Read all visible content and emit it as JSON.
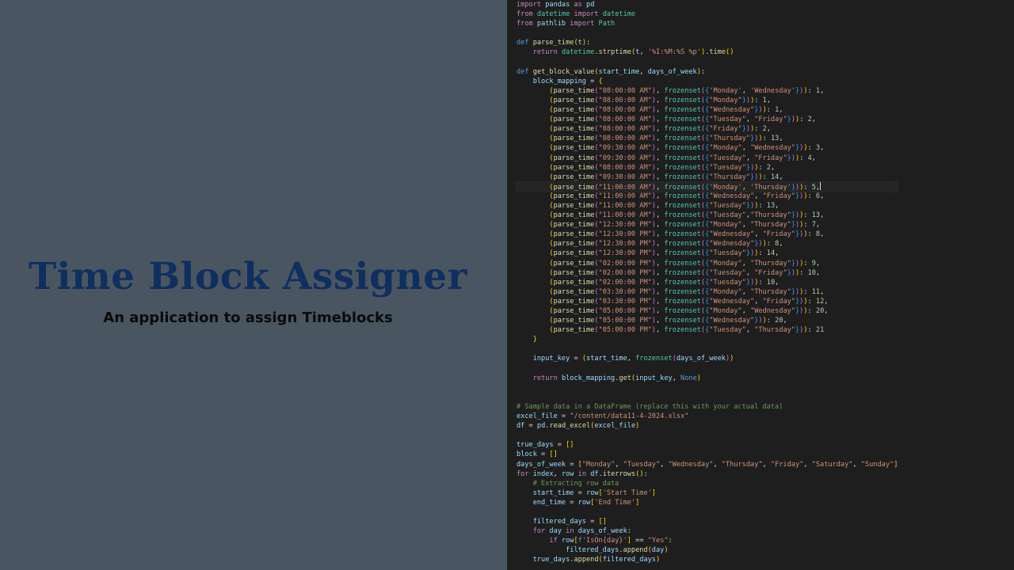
{
  "slide": {
    "title": "Time Block Assigner",
    "subtitle": "An application to assign Timeblocks"
  },
  "editor": {
    "cursor_line": 20,
    "lines": [
      "import pandas as pd",
      "from datetime import datetime",
      "from pathlib import Path",
      "",
      "def parse_time(t):",
      "    return datetime.strptime(t, '%I:%M:%S %p').time()",
      "",
      "def get_block_value(start_time, days_of_week):",
      "    block_mapping = {",
      "        (parse_time(\"08:00:00 AM\"), frozenset({'Monday', 'Wednesday'})): 1,",
      "        (parse_time(\"08:00:00 AM\"), frozenset({\"Monday\"})): 1,",
      "        (parse_time(\"08:00:00 AM\"), frozenset({\"Wednesday\"})): 1,",
      "        (parse_time(\"08:00:00 AM\"), frozenset({\"Tuesday\", \"Friday\"})): 2,",
      "        (parse_time(\"08:00:00 AM\"), frozenset({\"Friday\"})): 2,",
      "        (parse_time(\"08:00:00 AM\"), frozenset({\"Thursday\"})): 13,",
      "        (parse_time(\"09:30:00 AM\"), frozenset({\"Monday\", \"Wednesday\"})): 3,",
      "        (parse_time(\"09:30:00 AM\"), frozenset({\"Tuesday\", \"Friday\"})): 4,",
      "        (parse_time(\"08:00:00 AM\"), frozenset({\"Tuesday\"})): 2,",
      "        (parse_time(\"09:30:00 AM\"), frozenset({\"Thursday\"})): 14,",
      "        (parse_time(\"11:00:00 AM\"), frozenset({'Monday', 'Thursday'})): 5,",
      "        (parse_time(\"11:00:00 AM\"), frozenset({\"Wednesday\", \"Friday\"})): 6,",
      "        (parse_time(\"11:00:00 AM\"), frozenset({\"Tuesday\"})): 13,",
      "        (parse_time(\"11:00:00 AM\"), frozenset({\"Tuesday\",\"Thursday\"})): 13,",
      "        (parse_time(\"12:30:00 PM\"), frozenset({\"Monday\", \"Thursday\"})): 7,",
      "        (parse_time(\"12:30:00 PM\"), frozenset({\"Wednesday\", \"Friday\"})): 8,",
      "        (parse_time(\"12:30:00 PM\"), frozenset({\"Wednesday\"})): 8,",
      "        (parse_time(\"12:30:00 PM\"), frozenset({\"Tuesday\"})): 14,",
      "        (parse_time(\"02:00:00 PM\"), frozenset({\"Monday\", \"Thursday\"})): 9,",
      "        (parse_time(\"02:00:00 PM\"), frozenset({\"Tuesday\", \"Friday\"})): 10,",
      "        (parse_time(\"02:00:00 PM\"), frozenset({\"Tuesday\"})): 10,",
      "        (parse_time(\"03:30:00 PM\"), frozenset({\"Monday\", \"Thursday\"})): 11,",
      "        (parse_time(\"03:30:00 PM\"), frozenset({\"Wednesday\", \"Friday\"})): 12,",
      "        (parse_time(\"05:00:00 PM\"), frozenset({\"Monday\", \"Wednesday\"})): 20,",
      "        (parse_time(\"05:00:00 PM\"), frozenset({\"Wednesday\"})): 20,",
      "        (parse_time(\"05:00:00 PM\"), frozenset({\"Tuesday\", \"Thursday\"})): 21",
      "    }",
      "",
      "    input_key = (start_time, frozenset(days_of_week))",
      "",
      "    return block_mapping.get(input_key, None)",
      "",
      "",
      "# Sample data in a DataFrame (replace this with your actual data)",
      "excel_file = \"/content/data11-4-2024.xlsx\"",
      "df = pd.read_excel(excel_file)",
      "",
      "true_days = []",
      "block = []",
      "days_of_week = [\"Monday\", \"Tuesday\", \"Wednesday\", \"Thursday\", \"Friday\", \"Saturday\", \"Sunday\"]",
      "for index, row in df.iterrows():",
      "    # Extracting row data",
      "    start_time = row['Start Time']",
      "    end_time = row['End Time']",
      "",
      "    filtered_days = []",
      "    for day in days_of_week:",
      "        if row[f'IsOn{day}'] == \"Yes\":",
      "            filtered_days.append(day)",
      "    true_days.append(filtered_days)"
    ]
  },
  "colors": {
    "slide_background": "#4a5562",
    "title": "#0f2f5e",
    "subtitle": "#0b0b0b",
    "editor_background": "#1e1e1e"
  }
}
